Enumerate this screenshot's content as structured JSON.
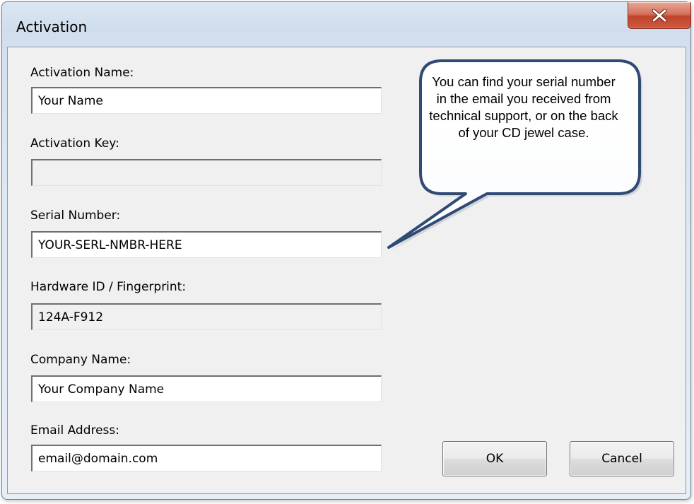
{
  "window": {
    "title": "Activation",
    "close_glyph": "X"
  },
  "form": {
    "activation_name": {
      "label": "Activation Name:",
      "value": "Your Name"
    },
    "activation_key": {
      "label": "Activation Key:",
      "value": ""
    },
    "serial_number": {
      "label": "Serial Number:",
      "value": "YOUR-SERL-NMBR-HERE"
    },
    "hardware_id": {
      "label": "Hardware ID / Fingerprint:",
      "value": "124A-F912"
    },
    "company_name": {
      "label": "Company Name:",
      "value": "Your Company Name"
    },
    "email_address": {
      "label": "Email Address:",
      "value": "email@domain.com"
    }
  },
  "buttons": {
    "ok_label": "OK",
    "cancel_label": "Cancel"
  },
  "callout": {
    "text": "You can find your serial number in the email you received from technical support, or on the back of your CD jewel case."
  },
  "colors": {
    "callout_border": "#2f4a73",
    "close_button": "#c7503a"
  }
}
